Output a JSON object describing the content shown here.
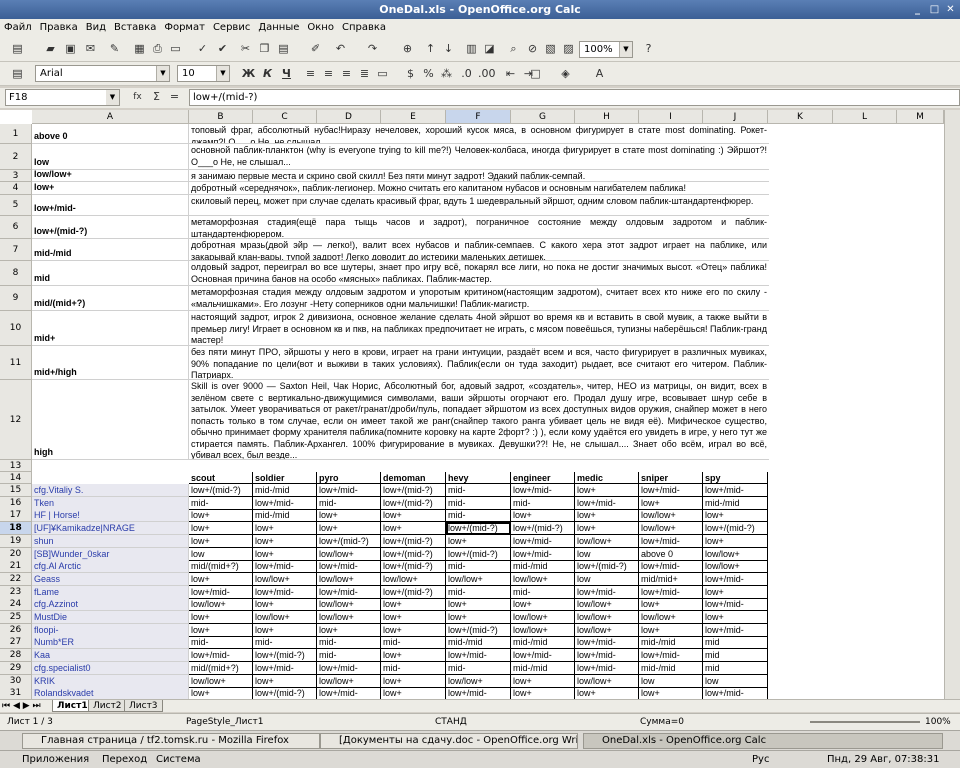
{
  "window": {
    "title": "OneDal.xls - OpenOffice.org Calc"
  },
  "menu": [
    "Файл",
    "Правка",
    "Вид",
    "Вставка",
    "Формат",
    "Сервис",
    "Данные",
    "Окно",
    "Справка"
  ],
  "toolbar": {
    "zoom": "100%",
    "font": "Arial",
    "size": "10",
    "bold": "Ж",
    "italic": "К",
    "underline": "Ч"
  },
  "formula_bar": {
    "cell_ref": "F18",
    "fx": "fx",
    "sum": "Σ",
    "eq": "=",
    "formula": "low+/(mid-?)"
  },
  "columns": [
    "A",
    "B",
    "C",
    "D",
    "E",
    "F",
    "G",
    "H",
    "I",
    "J",
    "K",
    "L",
    "M"
  ],
  "desc_rows": [
    {
      "row": "1",
      "label": "above 0",
      "text": "топовый фраг, абсолютный нубас!Ниразу нечеловек, хороший кусок мяса, в основном фигурирует в стате most dominating. Рокет-джамп?! О___о Не, не слышал..."
    },
    {
      "row": "2",
      "label": "low",
      "text": "основной паблик-планктон (why is everyone trying to kill me?!) Человек-колбаса, иногда фигурирует в стате most dominating :) Эйршот?! О___о Не, не слышал..."
    },
    {
      "row": "3",
      "label": "low/low+",
      "text": "я занимаю первые места и скрино свой скилл! Без пяти минут задрот! Эдакий паблик-семпай."
    },
    {
      "row": "4",
      "label": "low+",
      "text": "добротный «середнячок», паблик-легионер. Можно считать его капитаном нубасов и основным нагибателем паблика!"
    },
    {
      "row": "5",
      "label": "low+/mid-",
      "text": "скиловый перец, может при случае сделать красивый фраг, вдуть 1 шедевральный эйршот, одним словом паблик-штандартенфюрер."
    },
    {
      "row": "6",
      "label": "low+/(mid-?)",
      "text": "метаморфозная стадия(ещё пара тыщь часов и задрот), пограничное состояние между олдовым задротом и паблик-штандартенфюрером."
    },
    {
      "row": "7",
      "label": "mid-/mid",
      "text": "добротная мразь(двой эйр — легко!), валит всех нубасов и паблик-семпаев. С какого хера этот задрот играет на паблике, или закарывай клан-вары, тупой задрот! Легко доводит до истерики маленьких детишек."
    },
    {
      "row": "8",
      "label": "mid",
      "text": "олдовый задрот, переиграл во все шутеры, знает про игру всё, покарял все лиги, но пока не достиг значимых высот. «Отец» паблика! Основная причина банов на особо «мясных» пабликах. Паблик-мастер."
    },
    {
      "row": "9",
      "label": "mid/(mid+?)",
      "text": "метаморфозная стадия между олдовым задротом и упоротым критином(настоящим задротом), считает всех кто ниже его по скилу - «мальчишками». Его лозунг -Нету соперников одни мальчишки! Паблик-магистр."
    },
    {
      "row": "10",
      "label": "mid+",
      "text": "настоящий задрот, игрок 2 дивизиона, основное желание сделать 4ной эйршот во время кв и вставить в свой мувик, а также выйти в премьер лигу! Играет в основном кв и пкв, на пабликах предпочитает не играть, с мясом повеёшься, тупизны наберёшься! Паблик-гранд мастер!"
    },
    {
      "row": "11",
      "label": "mid+/high",
      "text": "без пяти минут ПРО, эйршоты у него в крови, играет на грани интуиции, раздаёт всем и вся, часто фигурирует в различных мувиках, 90% попадание по цели(вот и выживи в таких условиях). Паблик(если он туда заходит) рыдает, все считают его читером. Паблик-Патриарх."
    },
    {
      "row": "12",
      "label": "high",
      "text": "Skill is over 9000 — Saxton Heil, Чак Норис, Абсолютный бог, адовый задрот, «создатель», читер, НЕО из матрицы, он видит, всех в зелёном свете с вертикально-движущимися символами, ваши эйршоты огорчают его. Продал душу игре, всовывает шнур себе в затылок. Умеет уворачиваться от ракет/гранат/дроби/пуль, попадает эйршотом из всех доступных видов оружия, снайпер может в него попасть только в том случае, если он имеет такой же ранг(снайпер такого ранга убивает цель не видя её). Мифическое существо, обычно принимает форму хранителя паблика(помните коровку на карте 2форт? :) ), если кому удаётся его увидеть в игре, у него тут же стирается память. Паблик-Архангел. 100% фигурирование в мувиках. Девушки??! Не, не слышал.... Знает обо всём, играл во всё, убивал всех, был везде..."
    }
  ],
  "class_headers": [
    "scout",
    "soldier",
    "pyro",
    "demoman",
    "hevy",
    "engineer",
    "medic",
    "sniper",
    "spy"
  ],
  "players": [
    {
      "row": "15",
      "name": "cfg.Vitaliy S.",
      "v": [
        "low+/(mid-?)",
        "mid-/mid",
        "low+/mid-",
        "low+/(mid-?)",
        "mid-",
        "low+/mid-",
        "low+",
        "low+/mid-",
        "low+/mid-"
      ]
    },
    {
      "row": "16",
      "name": "Tken",
      "v": [
        "mid-",
        "low+/mid-",
        "mid-",
        "low+/(mid-?)",
        "mid-",
        "mid-",
        "low+/mid-",
        "low+",
        "mid-/mid"
      ]
    },
    {
      "row": "17",
      "name": "HF | Horse!",
      "v": [
        "low+",
        "mid-/mid",
        "low+",
        "low+",
        "mid-",
        "low+",
        "low+",
        "low/low+",
        "low+"
      ]
    },
    {
      "row": "18",
      "name": "[UF]¥Kamikadze|NRAGE",
      "v": [
        "low+",
        "low+",
        "low+",
        "low+",
        "low+/(mid-?)",
        "low+/(mid-?)",
        "low+",
        "low/low+",
        "low+/(mid-?)"
      ]
    },
    {
      "row": "19",
      "name": "shun",
      "v": [
        "low+",
        "low+",
        "low+/(mid-?)",
        "low+/(mid-?)",
        "low+",
        "low+/mid-",
        "low/low+",
        "low+/mid-",
        "low+"
      ]
    },
    {
      "row": "20",
      "name": "[SB]Wunder_0skar",
      "v": [
        "low",
        "low+",
        "low/low+",
        "low+/(mid-?)",
        "low+/(mid-?)",
        "low+/mid-",
        "low",
        "above 0",
        "low/low+"
      ]
    },
    {
      "row": "21",
      "name": "cfg.Al Arctic",
      "v": [
        "mid/(mid+?)",
        "low+/mid-",
        "low+/mid-",
        "low+/(mid-?)",
        "mid-",
        "mid-/mid",
        "low+/(mid-?)",
        "low+/mid-",
        "low/low+"
      ]
    },
    {
      "row": "22",
      "name": "Geass",
      "v": [
        "low+",
        "low/low+",
        "low/low+",
        "low/low+",
        "low/low+",
        "low/low+",
        "low",
        "mid/mid+",
        "low+/mid-"
      ]
    },
    {
      "row": "23",
      "name": "fLame",
      "v": [
        "low+/mid-",
        "low+/mid-",
        "low+/mid-",
        "low+/(mid-?)",
        "mid-",
        "mid-",
        "low+/mid-",
        "low+/mid-",
        "low+"
      ]
    },
    {
      "row": "24",
      "name": "cfg.Azzinot",
      "v": [
        "low/low+",
        "low+",
        "low/low+",
        "low+",
        "low+",
        "low+",
        "low/low+",
        "low+",
        "low+/mid-"
      ]
    },
    {
      "row": "25",
      "name": "MustDie",
      "v": [
        "low+",
        "low/low+",
        "low/low+",
        "low+",
        "low+",
        "low/low+",
        "low/low+",
        "low/low+",
        "low+"
      ]
    },
    {
      "row": "26",
      "name": "floopi-",
      "v": [
        "low+",
        "low+",
        "low+",
        "low+",
        "low+/(mid-?)",
        "low/low+",
        "low/low+",
        "low+",
        "low+/mid-"
      ]
    },
    {
      "row": "27",
      "name": "Numb*ER",
      "v": [
        "mid-",
        "mid-",
        "mid-",
        "mid-",
        "mid-/mid",
        "mid-/mid",
        "low+/mid-",
        "mid-/mid",
        "mid"
      ]
    },
    {
      "row": "28",
      "name": "Kaa",
      "v": [
        "low+/mid-",
        "low+/(mid-?)",
        "mid-",
        "low+",
        "low+/mid-",
        "low+/mid-",
        "low+/mid-",
        "low+/mid-",
        "mid"
      ]
    },
    {
      "row": "29",
      "name": "cfg.specialist0",
      "v": [
        "mid/(mid+?)",
        "low+/mid-",
        "low+/mid-",
        "mid-",
        "mid-",
        "mid-/mid",
        "low+/mid-",
        "mid-/mid",
        "mid"
      ]
    },
    {
      "row": "30",
      "name": "KRIK",
      "v": [
        "low/low+",
        "low+",
        "low/low+",
        "low+",
        "low/low+",
        "low+",
        "low/low+",
        "low",
        "low"
      ]
    },
    {
      "row": "31",
      "name": "Rolandskvadet",
      "v": [
        "low+",
        "low+/(mid-?)",
        "low+/mid-",
        "low+",
        "low+/mid-",
        "low+",
        "low+",
        "low+",
        "low+/mid-"
      ]
    }
  ],
  "sheets": [
    "Лист1",
    "Лист2",
    "Лист3"
  ],
  "status": {
    "sheet": "Лист 1 / 3",
    "style": "PageStyle_Лист1",
    "mode": "СТАНД",
    "sum": "Сумма=0",
    "zoom": "100%"
  },
  "taskbar": [
    {
      "label": "Главная страница / tf2.tomsk.ru - Mozilla Firefox",
      "active": false
    },
    {
      "label": "[Документы на сдачу.doc - OpenOffice.org Writ...",
      "active": false
    },
    {
      "label": "OneDal.xls - OpenOffice.org Calc",
      "active": true
    }
  ],
  "panel": {
    "apps": "Приложения",
    "places": "Переход",
    "system": "Система",
    "lang": "Рус",
    "clock": "Пнд, 29 Авг, 07:38:31"
  }
}
